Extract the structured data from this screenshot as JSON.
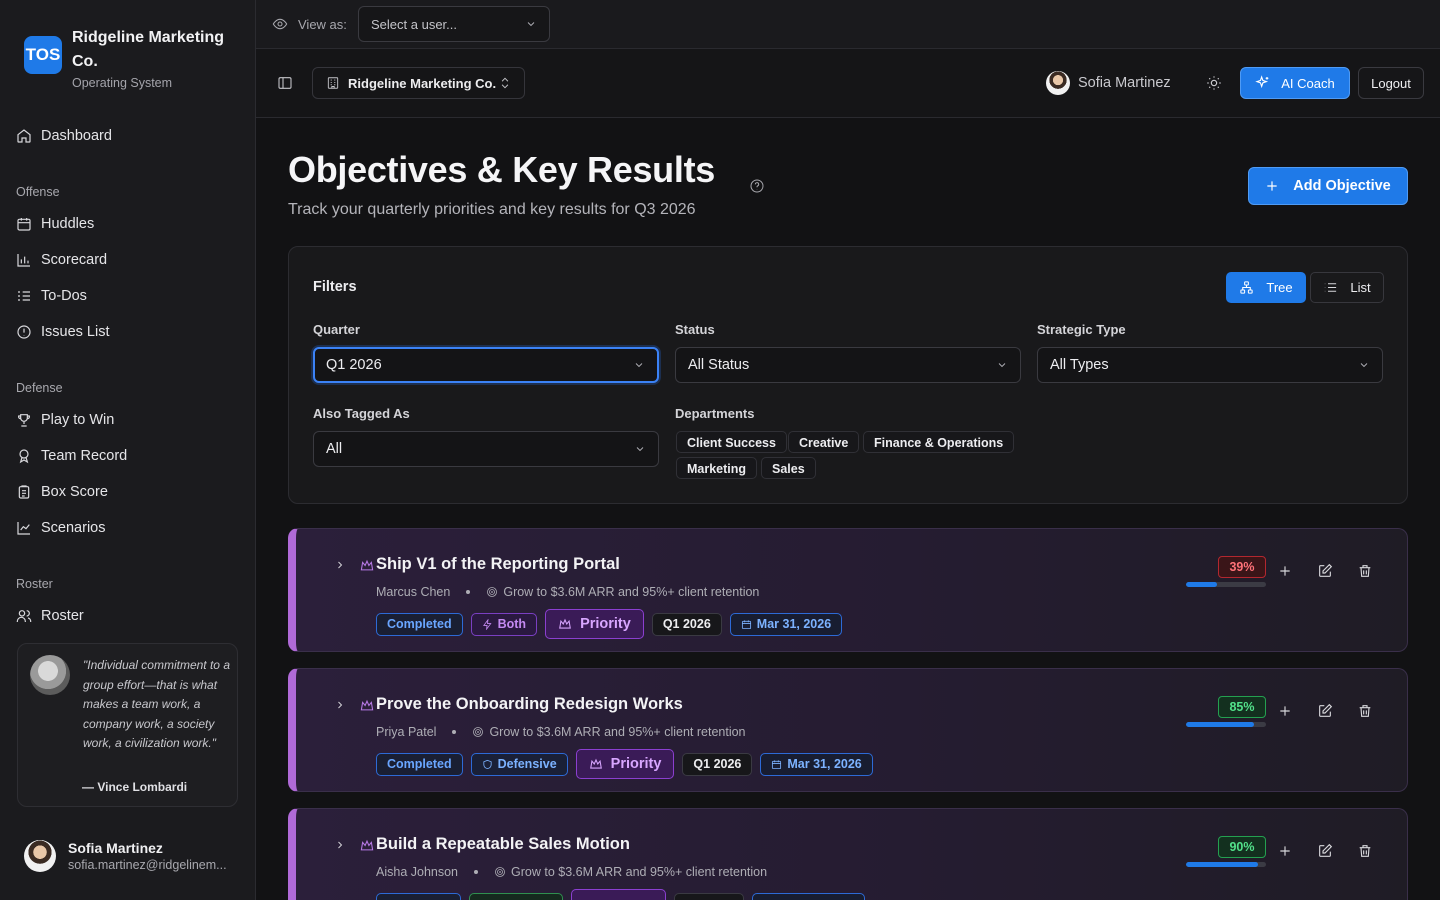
{
  "brand": {
    "logo_text": "TOS",
    "name": "Ridgeline Marketing Co.",
    "subtitle": "Operating System",
    "accent_color": "#1f7ae8"
  },
  "sidebar": {
    "dashboard": "Dashboard",
    "sections": {
      "offense": "Offense",
      "defense": "Defense",
      "roster": "Roster"
    },
    "offense_items": [
      "Huddles",
      "Scorecard",
      "To-Dos",
      "Issues List"
    ],
    "defense_items": [
      "Play to Win",
      "Team Record",
      "Box Score",
      "Scenarios"
    ],
    "roster_items": [
      "Roster"
    ],
    "quote": {
      "text": "\"Individual commitment to a group effort—that is what makes a team work, a company work, a society work, a civilization work.\"",
      "author": "— Vince Lombardi"
    },
    "user": {
      "name": "Sofia Martinez",
      "email": "sofia.martinez@ridgelinem..."
    }
  },
  "topbar": {
    "view_as_label": "View as:",
    "view_as_placeholder": "Select a user...",
    "company": "Ridgeline Marketing Co.",
    "user_name": "Sofia Martinez",
    "ai_coach": "AI Coach",
    "logout": "Logout"
  },
  "page": {
    "title": "Objectives & Key Results",
    "subtitle": "Track your quarterly priorities and key results for Q3 2026",
    "add_button": "Add Objective"
  },
  "filters": {
    "title": "Filters",
    "view_tree": "Tree",
    "view_list": "List",
    "quarter_label": "Quarter",
    "quarter_value": "Q1 2026",
    "status_label": "Status",
    "status_value": "All Status",
    "strategic_label": "Strategic Type",
    "strategic_value": "All Types",
    "tagged_label": "Also Tagged As",
    "tagged_value": "All",
    "departments_label": "Departments",
    "departments": [
      "Client Success",
      "Creative",
      "Finance & Operations",
      "Marketing",
      "Sales"
    ]
  },
  "objectives": [
    {
      "title": "Ship V1 of the Reporting Portal",
      "owner": "Marcus Chen",
      "parent": "Grow to $3.6M ARR and 95%+ client retention",
      "status": "Completed",
      "type": "Both",
      "priority": "Priority",
      "quarter": "Q1 2026",
      "due": "Mar 31, 2026",
      "progress_label": "39%",
      "progress": 39,
      "progress_color": "red"
    },
    {
      "title": "Prove the Onboarding Redesign Works",
      "owner": "Priya Patel",
      "parent": "Grow to $3.6M ARR and 95%+ client retention",
      "status": "Completed",
      "type": "Defensive",
      "priority": "Priority",
      "quarter": "Q1 2026",
      "due": "Mar 31, 2026",
      "progress_label": "85%",
      "progress": 85,
      "progress_color": "green"
    },
    {
      "title": "Build a Repeatable Sales Motion",
      "owner": "Aisha Johnson",
      "parent": "Grow to $3.6M ARR and 95%+ client retention",
      "progress_label": "90%",
      "progress": 90,
      "progress_color": "green"
    }
  ]
}
